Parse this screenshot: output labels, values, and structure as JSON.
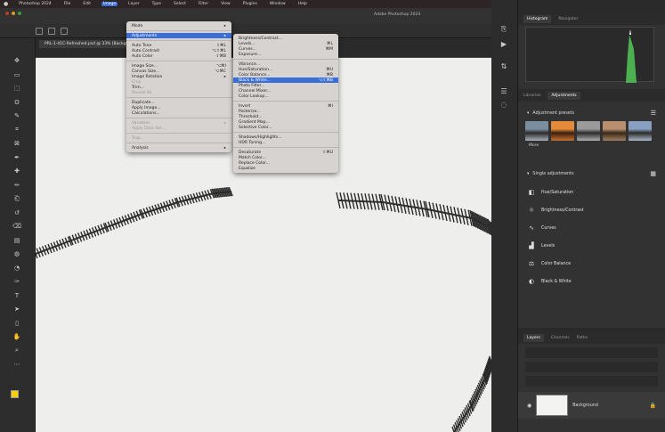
{
  "menubar": {
    "items": [
      "Photoshop 2024",
      "File",
      "Edit",
      "Image",
      "Layer",
      "Type",
      "Select",
      "Filter",
      "View",
      "Plugins",
      "Window",
      "Help"
    ],
    "active_index": 3
  },
  "titlebar": {
    "title": "Adobe Photoshop 2024"
  },
  "document": {
    "tab": "PRL-1-41C-Refreshed.psd @ 33% (Background, RGB/8)"
  },
  "image_menu": {
    "items": [
      {
        "label": "Mode",
        "shortcut": "",
        "arrow": "▸",
        "type": "item"
      },
      {
        "type": "sep"
      },
      {
        "label": "Adjustments",
        "shortcut": "",
        "arrow": "▸",
        "type": "highlight"
      },
      {
        "type": "sep"
      },
      {
        "label": "Auto Tone",
        "shortcut": "⇧⌘L",
        "type": "item"
      },
      {
        "label": "Auto Contrast",
        "shortcut": "⌥⇧⌘L",
        "type": "item"
      },
      {
        "label": "Auto Color",
        "shortcut": "⇧⌘B",
        "type": "item"
      },
      {
        "type": "sep"
      },
      {
        "label": "Image Size...",
        "shortcut": "⌥⌘I",
        "type": "item"
      },
      {
        "label": "Canvas Size...",
        "shortcut": "⌥⌘C",
        "type": "item"
      },
      {
        "label": "Image Rotation",
        "shortcut": "",
        "arrow": "▸",
        "type": "item"
      },
      {
        "label": "Crop",
        "shortcut": "",
        "type": "dim"
      },
      {
        "label": "Trim...",
        "shortcut": "",
        "type": "item"
      },
      {
        "label": "Reveal All",
        "shortcut": "",
        "type": "dim"
      },
      {
        "type": "sep"
      },
      {
        "label": "Duplicate...",
        "shortcut": "",
        "type": "item"
      },
      {
        "label": "Apply Image...",
        "shortcut": "",
        "type": "item"
      },
      {
        "label": "Calculations...",
        "shortcut": "",
        "type": "item"
      },
      {
        "type": "sep"
      },
      {
        "label": "Variables",
        "shortcut": "",
        "arrow": "▸",
        "type": "dim"
      },
      {
        "label": "Apply Data Set...",
        "shortcut": "",
        "type": "dim"
      },
      {
        "type": "sep"
      },
      {
        "label": "Trap...",
        "shortcut": "",
        "type": "dim"
      },
      {
        "type": "sep"
      },
      {
        "label": "Analysis",
        "shortcut": "",
        "arrow": "▸",
        "type": "item"
      }
    ]
  },
  "adjust_menu": {
    "items": [
      {
        "label": "Brightness/Contrast...",
        "shortcut": "",
        "type": "item"
      },
      {
        "label": "Levels...",
        "shortcut": "⌘L",
        "type": "item"
      },
      {
        "label": "Curves...",
        "shortcut": "⌘M",
        "type": "item"
      },
      {
        "label": "Exposure...",
        "shortcut": "",
        "type": "item"
      },
      {
        "type": "sep"
      },
      {
        "label": "Vibrance...",
        "shortcut": "",
        "type": "item"
      },
      {
        "label": "Hue/Saturation...",
        "shortcut": "⌘U",
        "type": "item"
      },
      {
        "label": "Color Balance...",
        "shortcut": "⌘B",
        "type": "item"
      },
      {
        "label": "Black & White...",
        "shortcut": "⌥⇧⌘B",
        "type": "sel"
      },
      {
        "label": "Photo Filter...",
        "shortcut": "",
        "type": "item"
      },
      {
        "label": "Channel Mixer...",
        "shortcut": "",
        "type": "item"
      },
      {
        "label": "Color Lookup...",
        "shortcut": "",
        "type": "item"
      },
      {
        "type": "sep"
      },
      {
        "label": "Invert",
        "shortcut": "⌘I",
        "type": "item"
      },
      {
        "label": "Posterize...",
        "shortcut": "",
        "type": "item"
      },
      {
        "label": "Threshold...",
        "shortcut": "",
        "type": "item"
      },
      {
        "label": "Gradient Map...",
        "shortcut": "",
        "type": "item"
      },
      {
        "label": "Selective Color...",
        "shortcut": "",
        "type": "item"
      },
      {
        "type": "sep"
      },
      {
        "label": "Shadows/Highlights...",
        "shortcut": "",
        "type": "item"
      },
      {
        "label": "HDR Toning...",
        "shortcut": "",
        "type": "item"
      },
      {
        "type": "sep"
      },
      {
        "label": "Desaturate",
        "shortcut": "⇧⌘U",
        "type": "item"
      },
      {
        "label": "Match Color...",
        "shortcut": "",
        "type": "item"
      },
      {
        "label": "Replace Color...",
        "shortcut": "",
        "type": "item"
      },
      {
        "label": "Equalize",
        "shortcut": "",
        "type": "item"
      }
    ]
  },
  "histogram_panel": {
    "tabs": [
      "Histogram",
      "Navigator"
    ],
    "active_tab": 0
  },
  "adjustments_panel": {
    "tabs": [
      "Libraries",
      "Adjustments"
    ],
    "active_tab": 1,
    "presets_header": "Adjustment presets",
    "more_label": "More",
    "single_header": "Single adjustments",
    "items": [
      {
        "label": "Hue/Saturation",
        "icon": "hue-saturation-icon",
        "glyph": "◧"
      },
      {
        "label": "Brightness/Contrast",
        "icon": "brightness-contrast-icon",
        "glyph": "☼"
      },
      {
        "label": "Curves",
        "icon": "curves-icon",
        "glyph": "∿"
      },
      {
        "label": "Levels",
        "icon": "levels-icon",
        "glyph": "▟"
      },
      {
        "label": "Color Balance",
        "icon": "color-balance-icon",
        "glyph": "⚖"
      },
      {
        "label": "Black & White",
        "icon": "black-white-icon",
        "glyph": "◐"
      }
    ]
  },
  "layers_panel": {
    "tabs": [
      "Layers",
      "Channels",
      "Paths"
    ],
    "active_tab": 0,
    "layer_name": "Background"
  },
  "colors": {
    "menu_highlight": "#3a6fd8",
    "canvas_bg": "#eeeeec",
    "panel_bg": "#323232",
    "histogram_green": "#4caf50"
  }
}
